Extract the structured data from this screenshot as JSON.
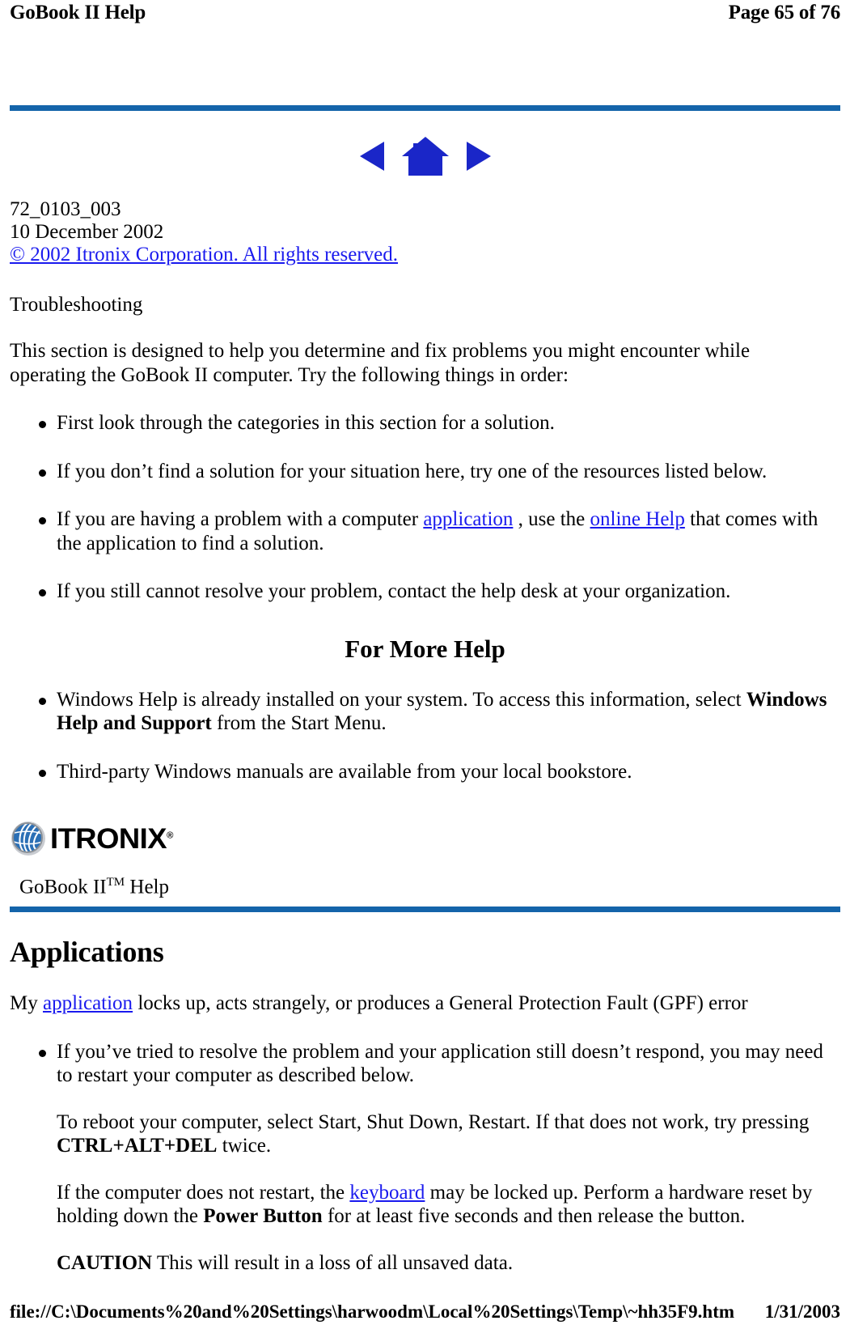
{
  "print_header": {
    "left": "GoBook II Help",
    "right": "Page 65 of 76"
  },
  "nav": {
    "back_label": "Back",
    "home_label": "Home",
    "forward_label": "Forward"
  },
  "meta": {
    "doc_number": "72_0103_003",
    "date": "10 December 2002",
    "copyright": "© 2002 Itronix Corporation.  All rights reserved."
  },
  "troubleshooting": {
    "label": "Troubleshooting",
    "intro": "This section is designed to help you determine and fix problems you might encounter while operating the GoBook II computer. Try the following things in order:",
    "bullets": [
      {
        "text": "First look through the categories in this section for a solution."
      },
      {
        "text": "If you don’t find a solution for your situation here, try one of the resources listed below."
      },
      {
        "pre": "If you are having a problem with a computer ",
        "link1": "application",
        "mid": " , use the ",
        "link2": "online Help",
        "post": " that comes with the application to find a solution."
      },
      {
        "text": "If you still cannot resolve your problem, contact the help desk at your organization."
      }
    ]
  },
  "more_help": {
    "heading": "For More Help",
    "bullets": [
      {
        "pre": "Windows Help is already installed on your system.  To access this information, select ",
        "bold": "Windows Help and Support",
        "post": " from the Start Menu."
      },
      {
        "text": "Third-party Windows manuals are available from your local bookstore."
      }
    ]
  },
  "logo": {
    "wordmark": "ITRONIX",
    "registered": "®"
  },
  "banner": {
    "title": "GoBook II",
    "trademark": "TM",
    "title_suffix": " Help"
  },
  "applications": {
    "heading": "Applications",
    "lead_pre": "My ",
    "lead_link": "application",
    "lead_post": " locks up, acts strangely, or produces a General Protection Fault (GPF) error",
    "bullet": {
      "text": "If you’ve tried to resolve the problem and your application still doesn’t respond, you may need to restart your computer as described below.",
      "sub1_pre": "To reboot your computer, select Start, Shut Down, Restart.  If that does not work, try pressing ",
      "sub1_bold": "CTRL+ALT+DEL",
      "sub1_post": " twice.",
      "sub2_pre": "If the computer does not restart, the ",
      "sub2_link": "keyboard",
      "sub2_mid": " may be locked up. Perform a hardware reset by holding down the ",
      "sub2_bold": "Power Button",
      "sub2_post": " for at least five seconds and then release the button.",
      "sub3_bold": "CAUTION",
      "sub3_post": " This will result in a loss of all unsaved data."
    }
  },
  "print_footer": {
    "path": "file://C:\\Documents%20and%20Settings\\harwoodm\\Local%20Settings\\Temp\\~hh35F9.htm",
    "date": "1/31/2003"
  },
  "colors": {
    "rule_blue": "#1464aa",
    "link_blue": "#1a1aee",
    "logo_blue": "#2b6fb5"
  }
}
